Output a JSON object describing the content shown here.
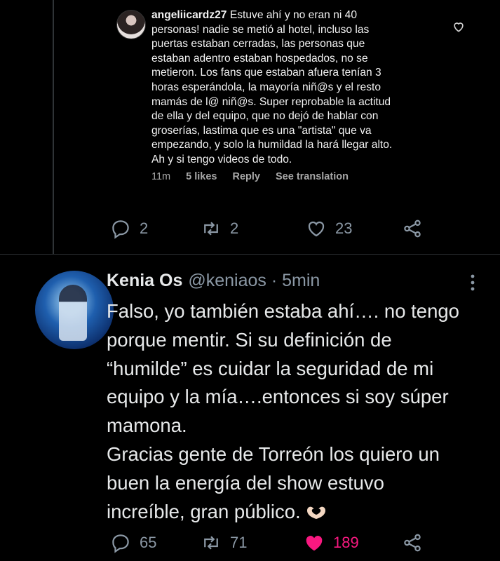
{
  "instagram_comment": {
    "username": "angeliicardz27",
    "text": "Estuve ahí y no eran ni 40\npersonas! nadie se metió al hotel, incluso las\npuertas estaban cerradas, las personas que\nestaban adentro estaban hospedados, no se\nmetieron. Los fans que estaban afuera tenían 3\nhoras esperándola, la mayoría niñ@s y el resto\nmamás de l@ niñ@s. Super reprobable la actitud\nde ella y del equipo, que no dejó de hablar con\ngroserías, lastima que es una \"artista\" que va\nempezando, y solo la humildad la hará llegar alto.\nAh y si tengo videos de todo.",
    "time": "11m",
    "likes": "5 likes",
    "reply": "Reply",
    "translate": "See translation"
  },
  "quoted_actions": {
    "replies": "2",
    "retweets": "2",
    "likes": "23"
  },
  "tweet": {
    "name": "Kenia Os",
    "handle": "@keniaos · 5min",
    "text": "Falso, yo también estaba ahí…. no tengo\nporque mentir. Si su definición de\n“humilde” es cuidar la seguridad de mi\nequipo y la mía….entonces si soy súper\nmamona.\nGracias gente de Torreón los quiero un\nbuen la energía del show estuvo\nincreíble, gran público.",
    "replies": "65",
    "retweets": "71",
    "likes": "189",
    "liked_color": "#f91880"
  }
}
